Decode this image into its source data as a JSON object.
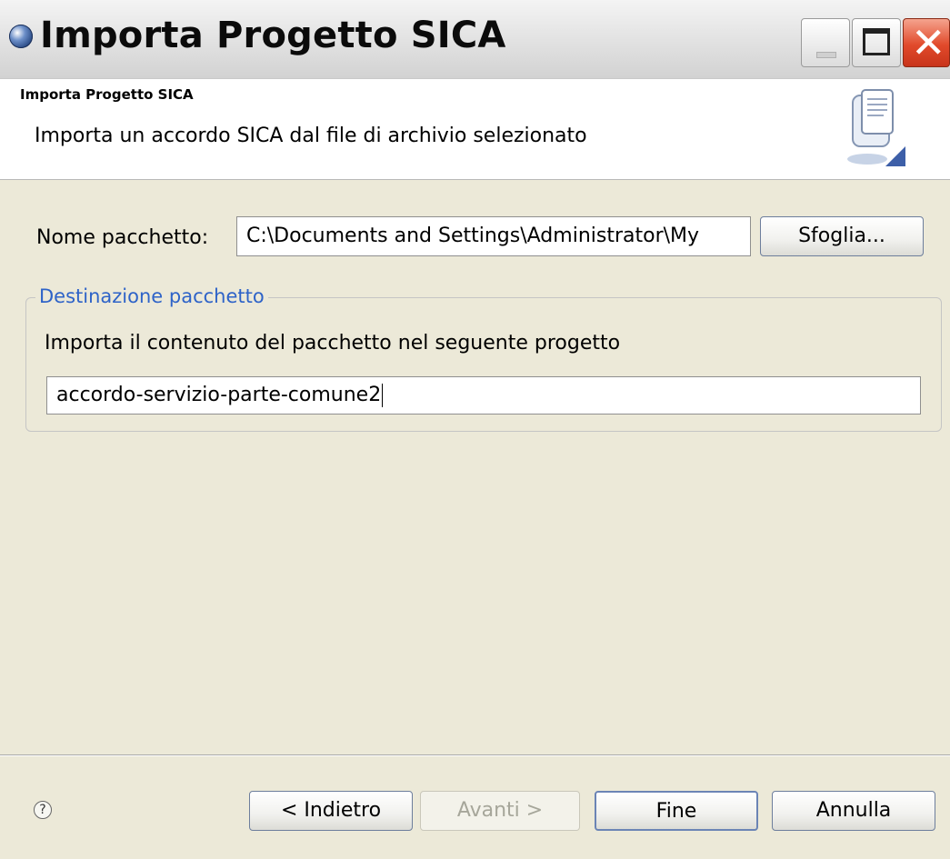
{
  "window": {
    "title": "Importa Progetto SICA",
    "app_icon": "globe-icon",
    "controls": {
      "minimize": "minimize-icon",
      "maximize": "maximize-icon",
      "close": "close-icon",
      "close_glyph": "✕"
    }
  },
  "banner": {
    "title": "Importa Progetto SICA",
    "description": "Importa un accordo SICA dal file di archivio selezionato",
    "icon": "import-wizard-icon"
  },
  "form": {
    "package_label": "Nome pacchetto:",
    "package_value": "C:\\Documents and Settings\\Administrator\\My",
    "browse_label": "Sfoglia...",
    "destination_group": {
      "legend": "Destinazione pacchetto",
      "description": "Importa il contenuto del pacchetto nel seguente progetto",
      "project_value": "accordo-servizio-parte-comune2"
    }
  },
  "footer": {
    "help_icon": "help-icon",
    "help_glyph": "?",
    "back_label": "< Indietro",
    "next_label": "Avanti >",
    "finish_label": "Fine",
    "cancel_label": "Annulla"
  },
  "colors": {
    "legend_blue": "#2e63c8",
    "close_red": "#e14a2b",
    "background": "#ece9d8"
  }
}
